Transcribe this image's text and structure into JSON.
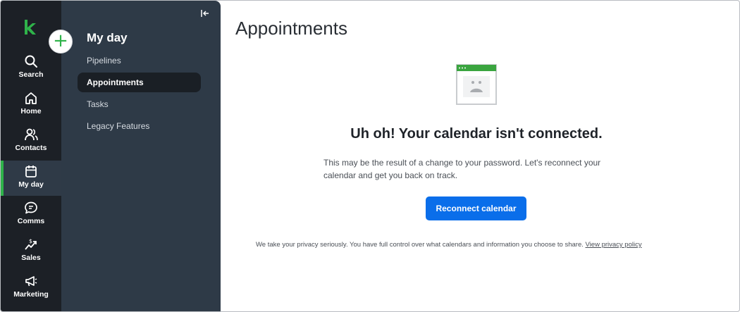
{
  "rail": {
    "items": [
      {
        "label": "Search",
        "icon": "search-icon"
      },
      {
        "label": "Home",
        "icon": "home-icon"
      },
      {
        "label": "Contacts",
        "icon": "contacts-icon"
      },
      {
        "label": "My day",
        "icon": "calendar-icon",
        "active": true
      },
      {
        "label": "Comms",
        "icon": "chat-icon"
      },
      {
        "label": "Sales",
        "icon": "sales-icon"
      },
      {
        "label": "Marketing",
        "icon": "megaphone-icon"
      }
    ]
  },
  "subnav": {
    "title": "My day",
    "add_label": "+",
    "items": [
      {
        "label": "Pipelines"
      },
      {
        "label": "Appointments",
        "active": true
      },
      {
        "label": "Tasks"
      },
      {
        "label": "Legacy Features"
      }
    ]
  },
  "main": {
    "title": "Appointments",
    "heading": "Uh oh! Your calendar isn't connected.",
    "description": "This may be the result of a change to your password. Let's reconnect your calendar and get you back on track.",
    "button_label": "Reconnect calendar",
    "privacy_text": "We take your privacy seriously. You have full control over what calendars and information you choose to share.",
    "privacy_link": "View privacy policy"
  },
  "colors": {
    "rail_bg": "#1c2026",
    "subnav_bg": "#2e3a47",
    "accent_green": "#2fb34a",
    "primary_blue": "#0a6eea"
  }
}
